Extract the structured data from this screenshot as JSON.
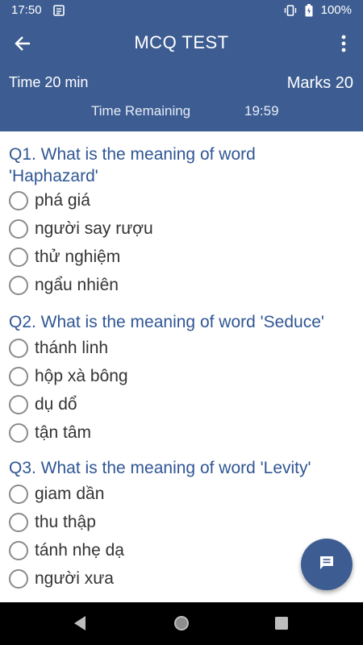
{
  "status_bar": {
    "time": "17:50",
    "battery_percent": "100%",
    "icons": [
      "notification-icon",
      "vibrate-icon",
      "battery-icon"
    ]
  },
  "app_bar": {
    "title": "MCQ TEST",
    "time_label": "Time 20 min",
    "marks_label": "Marks 20",
    "remaining_label": "Time Remaining",
    "remaining_value": "19:59",
    "icons": [
      "back-arrow-icon",
      "more-vert-icon"
    ]
  },
  "questions": [
    {
      "text_line1": "Q1. What is the meaning of word",
      "text_line2": "'Haphazard'",
      "options": [
        "phá giá",
        "người say rượu",
        "thử nghiệm",
        "ngẩu nhiên"
      ]
    },
    {
      "text_line1": "Q2. What is the meaning of word 'Seduce'",
      "options": [
        "thánh linh",
        "hộp xà bông",
        "dụ dổ",
        "tận tâm"
      ]
    },
    {
      "text_line1": "Q3. What is the meaning of word 'Levity'",
      "options": [
        "giam dần",
        "thu thập",
        "tánh nhẹ dạ",
        "người xưa"
      ]
    }
  ],
  "fab": {
    "icon": "chat-icon"
  },
  "nav_bar": {
    "icons": [
      "nav-back-icon",
      "nav-home-icon",
      "nav-recents-icon"
    ]
  },
  "colors": {
    "primary": "#3d5d92",
    "question_text": "#2f5694",
    "option_text": "#333333"
  }
}
